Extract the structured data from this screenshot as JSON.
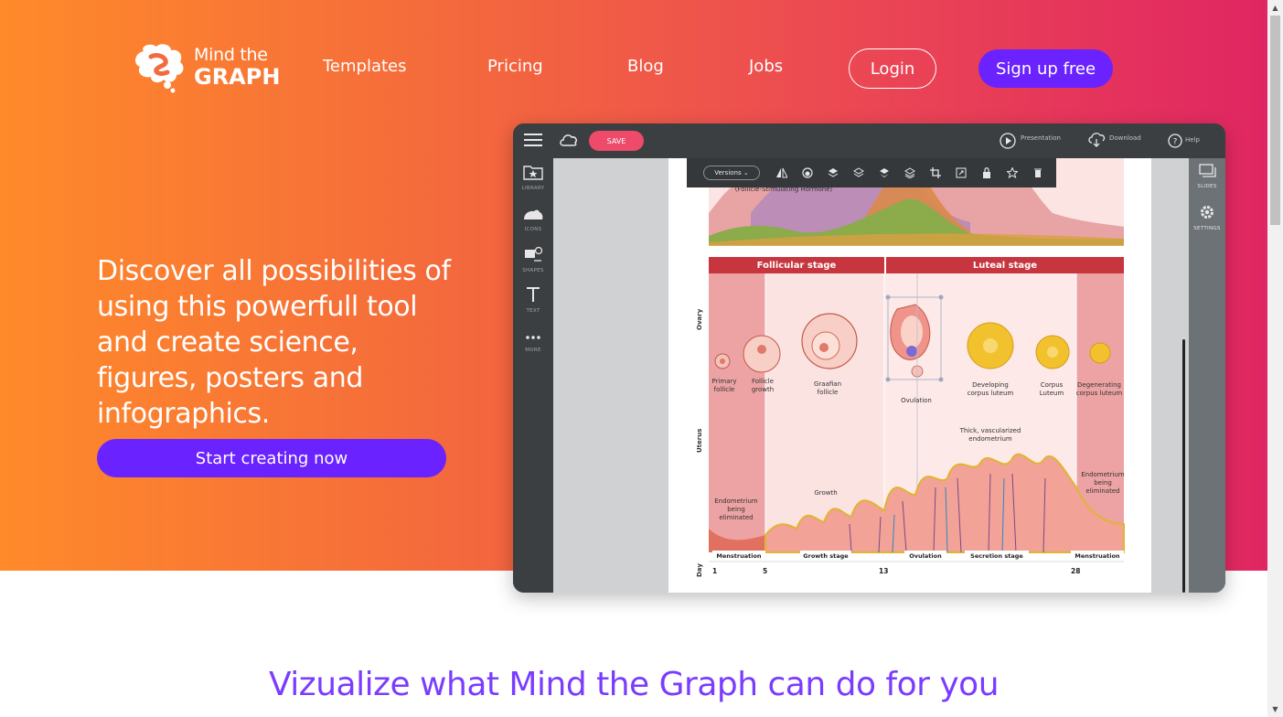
{
  "brand": {
    "top": "Mind the",
    "bottom": "GRAPH"
  },
  "nav": {
    "links": [
      "Templates",
      "Pricing",
      "Blog",
      "Jobs"
    ],
    "login": "Login",
    "signup": "Sign up free"
  },
  "hero": {
    "headline": "Discover all possibilities of using this powerfull tool and create science, figures, posters and infographics.",
    "cta": "Start creating now"
  },
  "app": {
    "save": "SAVE",
    "presentation": "Presentation",
    "download": "Download",
    "help": "Help",
    "versions": "Versions",
    "rail": [
      "LIBRARY",
      "ICONS",
      "SHAPES",
      "TEXT",
      "MORE"
    ],
    "right_rail": [
      "SLIDES",
      "SETTINGS"
    ],
    "diagram": {
      "hormone": "(Follicle-Stimulating Hormone)",
      "stages": [
        "Follicular stage",
        "Luteal stage"
      ],
      "ovary_label": "Ovary",
      "uterus_label": "Uterus",
      "day_label": "Day",
      "follicles": [
        "Primary follicle",
        "Follicle growth",
        "Graafian follicle",
        "Ovulation",
        "Developing corpus luteum",
        "Corpus Luteum",
        "Degenerating corpus luteum"
      ],
      "uterus_notes": [
        "Thick, vascularized endometrium",
        "Endometrium being eliminated",
        "Growth",
        "Endometrium being eliminated"
      ],
      "phases": [
        "Menstruation",
        "Growth stage",
        "Ovulation",
        "Secretion stage",
        "Menstruation"
      ],
      "days": [
        "1",
        "5",
        "13",
        "28"
      ]
    }
  },
  "section_title": "Vizualize what Mind the Graph can do for you",
  "colors": {
    "accent": "#6a22ff",
    "title": "#7a3cff",
    "gradient_start": "#ff8a2a",
    "gradient_end": "#e02662"
  }
}
